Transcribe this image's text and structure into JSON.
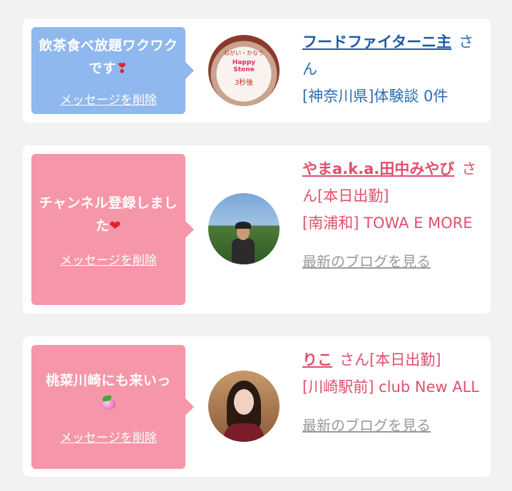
{
  "cards": [
    {
      "message": "飲茶食べ放題ワクワクです",
      "message_emoji": "❣",
      "delete_label": "メッセージを削除",
      "bubble_color": "#8fb8ee",
      "avatar": {
        "cake_top": "ねがい・かなう",
        "cake_mid": "Happy Stone",
        "cake_bot": "3秒後"
      },
      "name": "フードファイターニ主",
      "honorific": "さん",
      "line2": "[神奈川県]体験談 0件",
      "blog_label": ""
    },
    {
      "message": "チャンネル登録しました",
      "message_emoji": "❤",
      "delete_label": "メッセージを削除",
      "bubble_color": "#f597a8",
      "name": "やまa.k.a.田中みやび",
      "honorific": "さん[本日出勤]",
      "line2": "[南浦和] TOWA E MORE",
      "blog_label": "最新のブログを見る"
    },
    {
      "message": "桃菜川崎にも来いっ",
      "delete_label": "メッセージを削除",
      "bubble_color": "#f597a8",
      "name": "りこ",
      "honorific": "さん[本日出勤]",
      "line2": "[川崎駅前] club New ALL",
      "blog_label": "最新のブログを見る"
    }
  ]
}
